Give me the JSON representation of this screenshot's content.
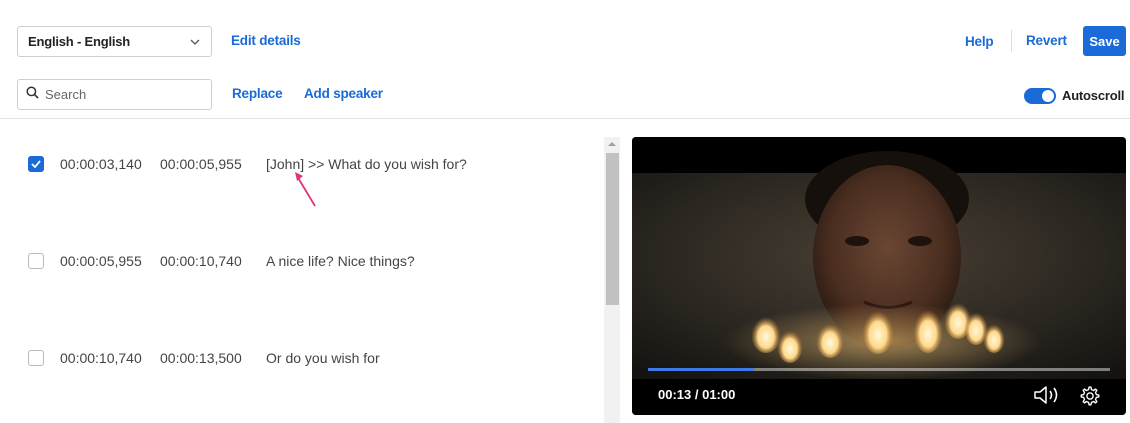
{
  "toolbar": {
    "language": "English - English",
    "edit_details": "Edit details",
    "help": "Help",
    "revert": "Revert",
    "save": "Save"
  },
  "tools": {
    "search_placeholder": "Search",
    "replace": "Replace",
    "add_speaker": "Add speaker",
    "autoscroll": "Autoscroll",
    "autoscroll_on": true
  },
  "captions": [
    {
      "checked": true,
      "start": "00:00:03,140",
      "end": "00:00:05,955",
      "text": "[John] >> What do you wish for?"
    },
    {
      "checked": false,
      "start": "00:00:05,955",
      "end": "00:00:10,740",
      "text": "A nice life? Nice things?"
    },
    {
      "checked": false,
      "start": "00:00:10,740",
      "end": "00:00:13,500",
      "text": "Or do you wish for"
    }
  ],
  "player": {
    "time": "00:13 / 01:00",
    "progress": 0.23
  },
  "colors": {
    "accent": "#1a6ad8",
    "annotation_arrow": "#e0357a"
  }
}
